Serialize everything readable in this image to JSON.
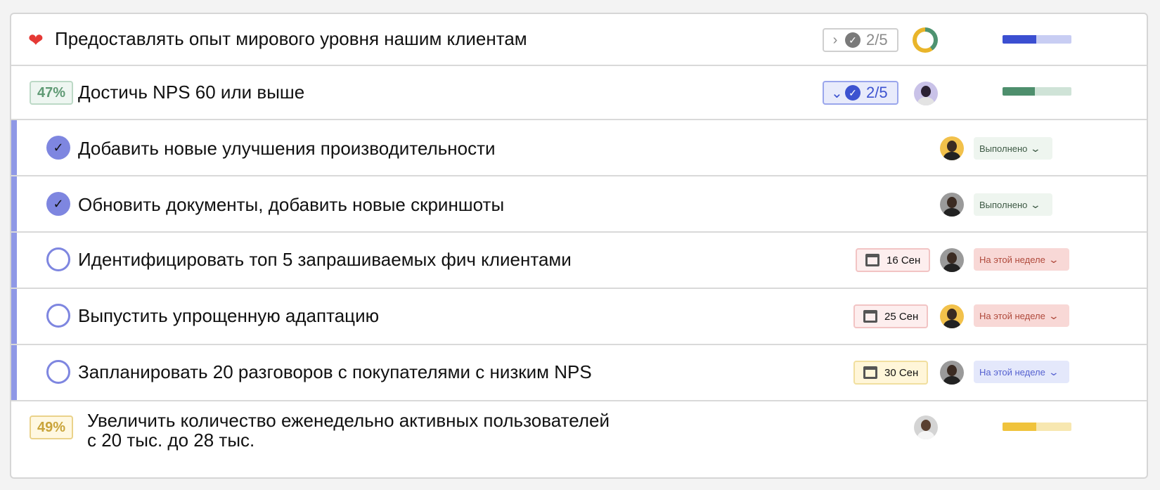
{
  "objective": {
    "icon": "heart-icon",
    "title": "Предоставлять опыт мирового уровня нашим клиентам",
    "counter": "2/5",
    "progress": 0.49
  },
  "key_results": [
    {
      "percent": "47%",
      "title": "Достичь NPS 60 или выше",
      "counter": "2/5",
      "progress": 0.47,
      "color": "#4e8f6d",
      "track": "#cfe3d7",
      "tasks": [
        {
          "title": "Добавить новые улучшения производительности",
          "done": true,
          "date": "",
          "status": "Выполнено",
          "status_kind": "done",
          "avatar": "yellow"
        },
        {
          "title": "Обновить документы, добавить новые скриншоты",
          "done": true,
          "date": "",
          "status": "Выполнено",
          "status_kind": "done",
          "avatar": "grey"
        },
        {
          "title": "Идентифицировать топ 5 запрашиваемых фич клиентами",
          "done": false,
          "date": "16 Сен",
          "date_kind": "red",
          "status": "На этой неделе",
          "status_kind": "red",
          "avatar": "grey"
        },
        {
          "title": "Выпустить упрощенную адаптацию",
          "done": false,
          "date": "25 Сен",
          "date_kind": "red",
          "status": "На этой неделе",
          "status_kind": "red",
          "avatar": "yellow"
        },
        {
          "title": "Запланировать 20 разговоров с покупателями с низким NPS",
          "done": false,
          "date": "30 Сен",
          "date_kind": "yellow",
          "status": "На этой неделе",
          "status_kind": "blue",
          "avatar": "grey"
        }
      ]
    },
    {
      "percent": "49%",
      "title_line1": "Увеличить количество еженедельно активных пользователей",
      "title_line2": "с 20 тыс. до 28 тыс.",
      "progress": 0.49,
      "color": "#f0c33c",
      "track": "#f7e7b0"
    }
  ],
  "objective_bar": {
    "color": "#3b4fd1",
    "track": "#c8cdf3"
  }
}
